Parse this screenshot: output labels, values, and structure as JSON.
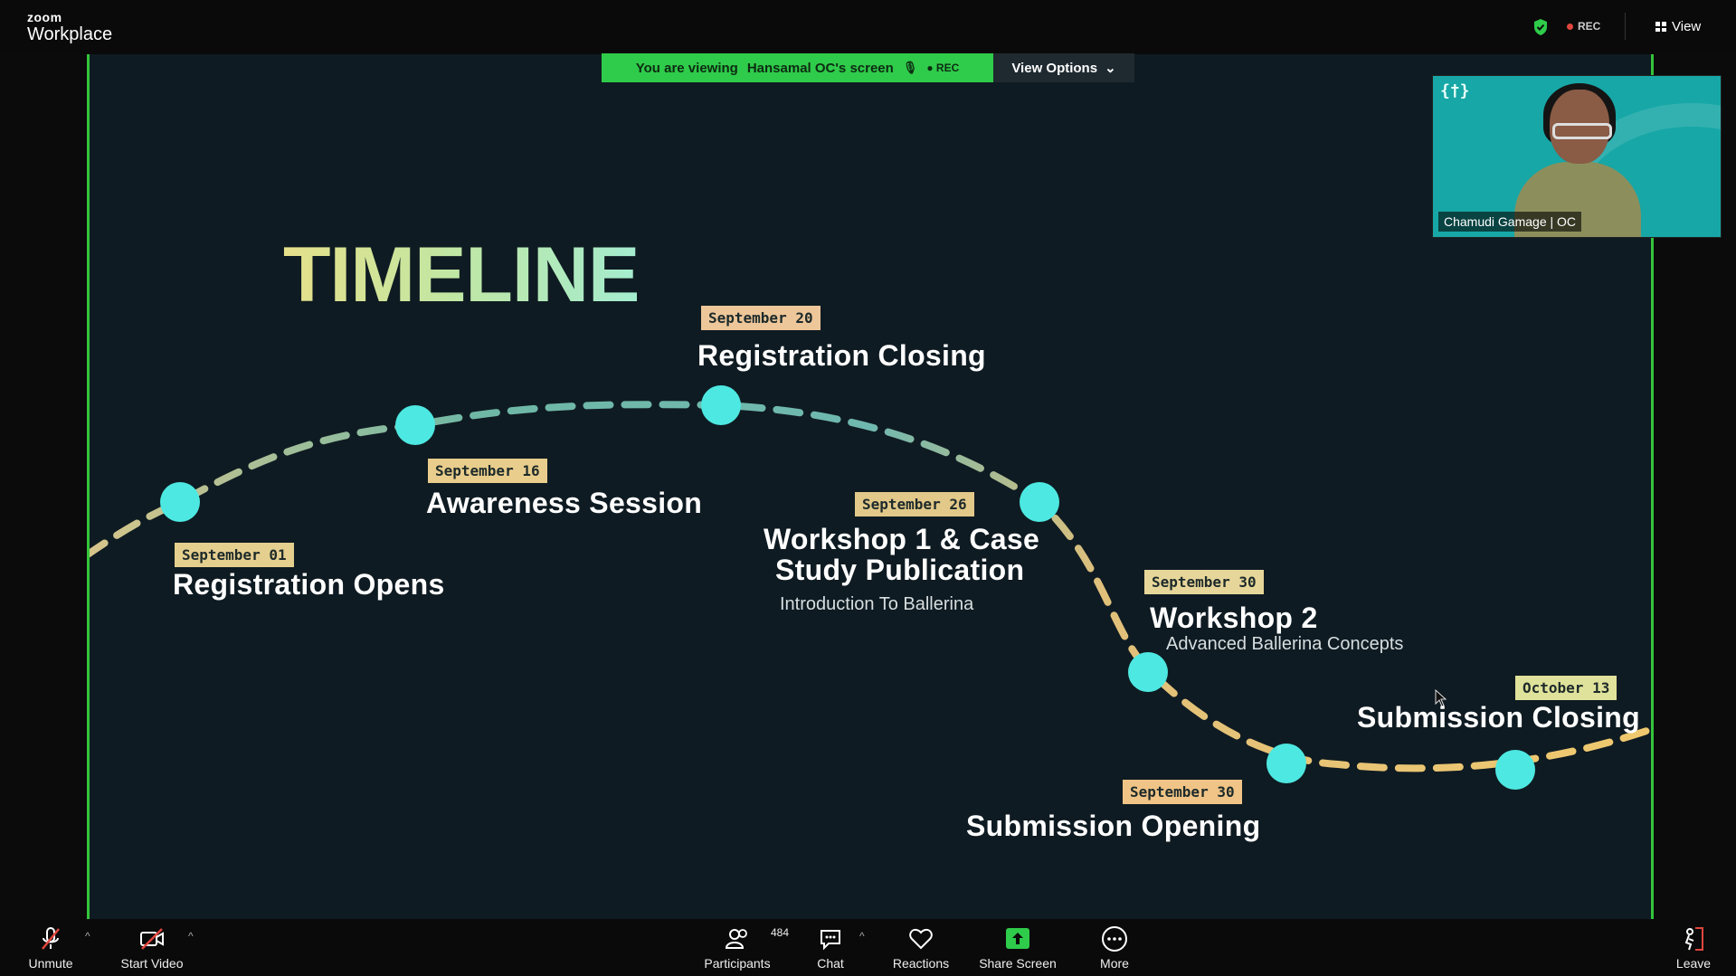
{
  "app": {
    "brand_small": "zoom",
    "brand_large": "Workplace"
  },
  "topbar": {
    "rec_label": "REC",
    "view_label": "View"
  },
  "banner": {
    "viewing_prefix": "You are viewing",
    "viewing_name": "Hansamal OC's screen",
    "rec_label": "REC",
    "view_options_label": "View Options"
  },
  "slide": {
    "title": "TIMELINE",
    "events": [
      {
        "date": "September 01",
        "title": "Registration Opens",
        "subtitle": ""
      },
      {
        "date": "September 16",
        "title": "Awareness Session",
        "subtitle": ""
      },
      {
        "date": "September 20",
        "title": "Registration Closing",
        "subtitle": ""
      },
      {
        "date": "September 26",
        "title_line1": "Workshop 1 & Case",
        "title_line2": "Study Publication",
        "subtitle": "Introduction To Ballerina"
      },
      {
        "date": "September 30",
        "title": "Workshop 2",
        "subtitle": "Advanced Ballerina Concepts"
      },
      {
        "date": "September 30",
        "title": "Submission Opening",
        "subtitle": ""
      },
      {
        "date": "October 13",
        "title": "Submission Closing",
        "subtitle": ""
      }
    ],
    "colors": {
      "node": "#4de8e1",
      "tag_green": "#a9e8b3",
      "tag_orange": "#f3c08a",
      "tag_yellow": "#dfe29a"
    }
  },
  "video": {
    "logo": "{†}",
    "participant_name": "Chamudi Gamage | OC"
  },
  "toolbar": {
    "unmute": "Unmute",
    "start_video": "Start Video",
    "participants": "Participants",
    "participants_count": "484",
    "chat": "Chat",
    "reactions": "Reactions",
    "share_screen": "Share Screen",
    "more": "More",
    "leave": "Leave"
  }
}
